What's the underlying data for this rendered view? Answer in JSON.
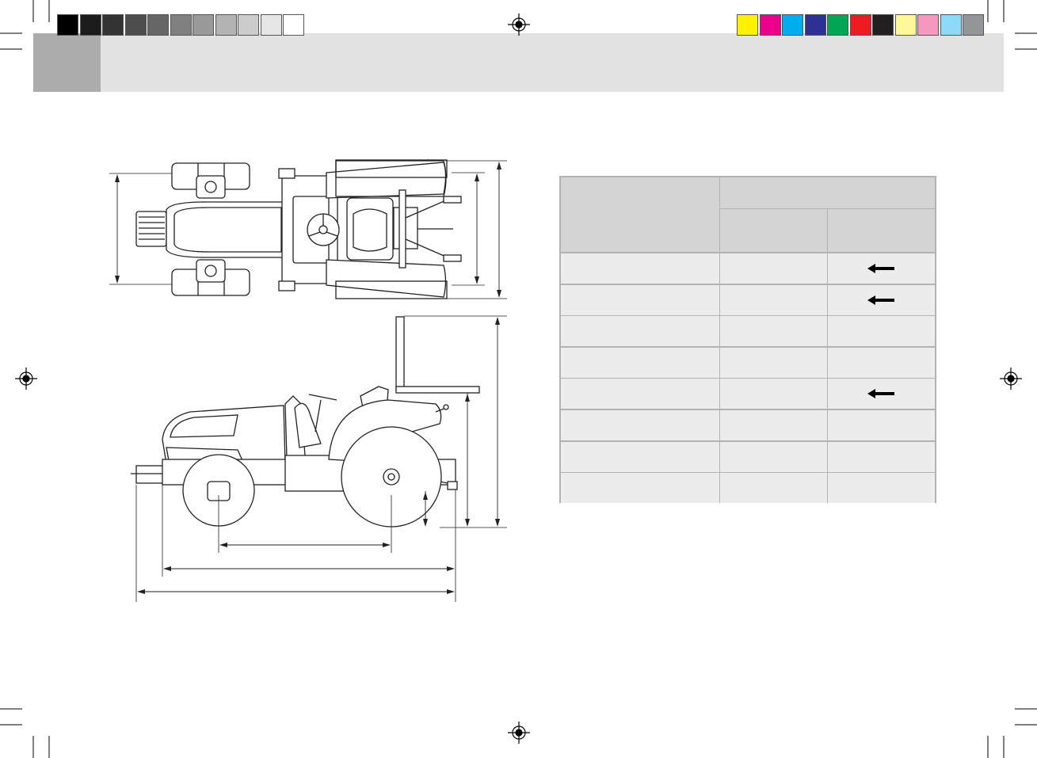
{
  "colors": {
    "grayscale_bar": [
      "#000000",
      "#1b1b1b",
      "#333333",
      "#4d4d4d",
      "#666666",
      "#808080",
      "#999999",
      "#b3b3b3",
      "#cccccc",
      "#e6e6e6",
      "#ffffff"
    ],
    "color_bar": [
      "#fff200",
      "#ec008c",
      "#00aeef",
      "#2e3192",
      "#00a651",
      "#ed1c24",
      "#231f20",
      "#fff799",
      "#f49ac1",
      "#8ed8f8",
      "#939598"
    ],
    "header_band": "#e2e2e2",
    "header_tab": "#acacac",
    "table_header": "#d4d4d4",
    "table_body": "#ececec",
    "table_border": "#b3b3b3"
  },
  "icons": {
    "registration_mark": "crosshair-circle-icon",
    "row_arrow": "arrow-left-icon"
  },
  "spec_table": {
    "rows_with_arrow": [
      true,
      true,
      false,
      false,
      true,
      false,
      false,
      false
    ]
  }
}
